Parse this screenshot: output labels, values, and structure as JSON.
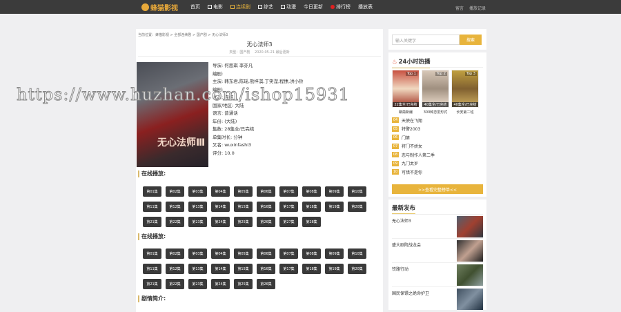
{
  "header": {
    "logo": "蜂猫影视",
    "nav": [
      {
        "label": "首页",
        "icon": false
      },
      {
        "label": "电影",
        "icon": true
      },
      {
        "label": "连续剧",
        "icon": true,
        "active": true
      },
      {
        "label": "综艺",
        "icon": true
      },
      {
        "label": "动漫",
        "icon": true
      },
      {
        "label": "今日更新",
        "icon": false
      },
      {
        "label": "排行榜",
        "dot": true
      },
      {
        "label": "播放表",
        "icon": false
      }
    ],
    "right": [
      "留言",
      "播放记录"
    ]
  },
  "breadcrumb": "当前位置：蜂猫影视 > 全部连续剧 > 国产剧 > 无心法师3",
  "movie": {
    "title": "无心法师3",
    "meta": "类型：国产剧　 2020-05-21 最后更新",
    "poster_text": "无心法师Ⅲ",
    "info": [
      "导演: 何思琪 李亦凡",
      "编剧:",
      "主演: 韩东君,陈瑶,熊梓淇,丁笑滢,程愫,洪小铃",
      "编剧:",
      "状态: 完结",
      "国家/地区: 大陆",
      "语言: 普通话",
      "年份: (大陆)",
      "集数: 28集全/已完结",
      "单集时长: 分钟",
      "又名: wuxinfashi3",
      "评分: 10.0"
    ]
  },
  "sections": [
    {
      "title": "在线播放:",
      "episodes": [
        "第01集",
        "第02集",
        "第03集",
        "第04集",
        "第05集",
        "第06集",
        "第07集",
        "第08集",
        "第09集",
        "第10集",
        "第11集",
        "第12集",
        "第13集",
        "第14集",
        "第15集",
        "第16集",
        "第17集",
        "第18集",
        "第19集",
        "第20集",
        "第21集",
        "第22集",
        "第23集",
        "第24集",
        "第25集",
        "第26集",
        "第27集",
        "第28集"
      ]
    },
    {
      "title": "在线播放:",
      "episodes": [
        "第01集",
        "第02集",
        "第03集",
        "第04集",
        "第05集",
        "第06集",
        "第07集",
        "第08集",
        "第09集",
        "第10集",
        "第11集",
        "第12集",
        "第13集",
        "第14集",
        "第15集",
        "第16集",
        "第17集",
        "第18集",
        "第19集",
        "第20集",
        "第21集",
        "第22集",
        "第23集",
        "第24集",
        "第25集",
        "第26集"
      ]
    }
  ],
  "synopsis_title": "剧情简介:",
  "search": {
    "placeholder": "输入关键字",
    "button": "搜索"
  },
  "hot": {
    "title": "24小时热播",
    "tops": [
      {
        "label": "Top 1",
        "badge": "22集全/已完结",
        "name": "聊斋新编"
      },
      {
        "label": "Top 2",
        "badge": "40集全/已完结",
        "name": "300种恋爱形式"
      },
      {
        "label": "Top 3",
        "badge": "40集全/已完结",
        "name": "长安第二班"
      }
    ],
    "list": [
      {
        "n": "04",
        "t": "天使在飞翔"
      },
      {
        "n": "05",
        "t": "特警2003"
      },
      {
        "n": "06",
        "t": "门第"
      },
      {
        "n": "07",
        "t": "将门不娇女"
      },
      {
        "n": "08",
        "t": "恋与制作人第二季"
      },
      {
        "n": "09",
        "t": "九门太岁"
      },
      {
        "n": "10",
        "t": "可惜不是你"
      }
    ],
    "more": ">>查看完整榜单<<"
  },
  "latest": {
    "title": "最新发布",
    "items": [
      "无心法师3",
      "盛大剧院战龙会",
      "铁路行动",
      "国民保镖之绝命护卫"
    ]
  },
  "watermark": "https://www.huzhan.com/ishop15931"
}
